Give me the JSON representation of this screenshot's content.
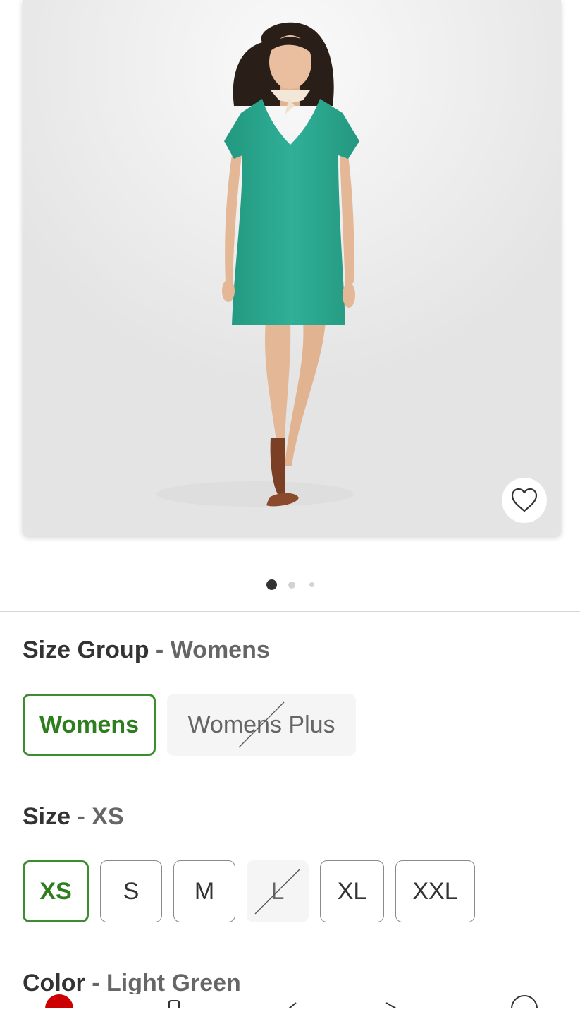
{
  "gallery": {
    "image_alt": "Woman wearing a light green short sleeve V-neck t-shirt dress with a neck scarf and brown sandals",
    "favorite_icon": "heart-icon",
    "page_count": 3,
    "active_page": 1
  },
  "size_group": {
    "title": "Size Group",
    "separator": "-",
    "selected_value": "Womens",
    "options": [
      {
        "label": "Womens",
        "state": "selected"
      },
      {
        "label": "Womens Plus",
        "state": "unavailable"
      }
    ]
  },
  "size": {
    "title": "Size",
    "separator": "-",
    "selected_value": "XS",
    "options": [
      {
        "label": "XS",
        "state": "selected"
      },
      {
        "label": "S",
        "state": "available"
      },
      {
        "label": "M",
        "state": "available"
      },
      {
        "label": "L",
        "state": "unavailable"
      },
      {
        "label": "XL",
        "state": "available"
      },
      {
        "label": "XXL",
        "state": "available"
      }
    ]
  },
  "color": {
    "title": "Color",
    "separator": "-",
    "selected_value": "Light Green"
  },
  "colors": {
    "selected_green": "#3b8e2d",
    "dress": "#2aa58e",
    "brand_red": "#cc0000"
  }
}
